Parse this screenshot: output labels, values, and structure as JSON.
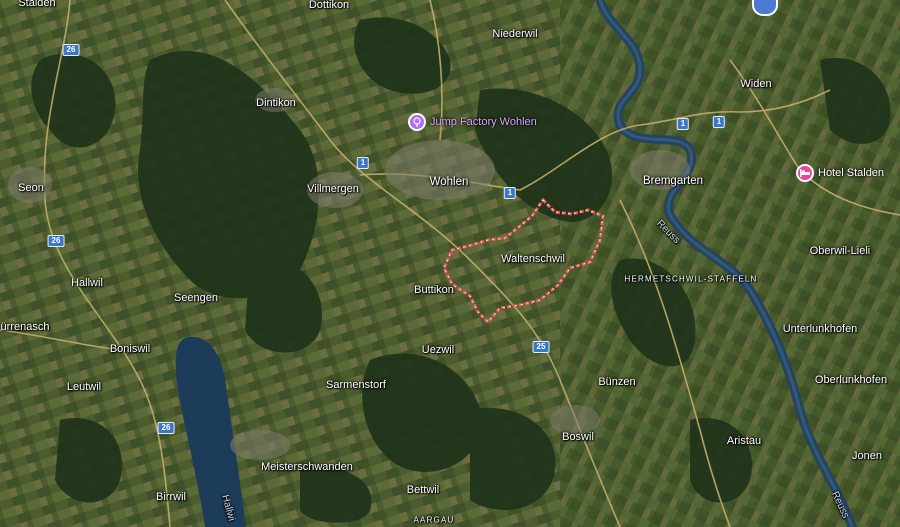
{
  "map": {
    "places": [
      {
        "id": "stalden",
        "label": "Stalden",
        "kind": "village"
      },
      {
        "id": "dottikon",
        "label": "Dottikon",
        "kind": "village"
      },
      {
        "id": "niederwil",
        "label": "Niederwil",
        "kind": "village"
      },
      {
        "id": "widen",
        "label": "Widen",
        "kind": "village"
      },
      {
        "id": "dintikon",
        "label": "Dintikon",
        "kind": "village"
      },
      {
        "id": "seon",
        "label": "Seon",
        "kind": "village"
      },
      {
        "id": "villmergen",
        "label": "Villmergen",
        "kind": "village"
      },
      {
        "id": "wohlen",
        "label": "Wohlen",
        "kind": "town"
      },
      {
        "id": "bremgarten",
        "label": "Bremgarten",
        "kind": "town"
      },
      {
        "id": "oberwil-lieli",
        "label": "Oberwil-Lieli",
        "kind": "village"
      },
      {
        "id": "waltenschwil",
        "label": "Waltenschwil",
        "kind": "village"
      },
      {
        "id": "hermetschwil-staffeln",
        "label": "HERMETSCHWIL-STAFFELN",
        "kind": "district"
      },
      {
        "id": "hallwil",
        "label": "Hallwil",
        "kind": "village"
      },
      {
        "id": "seengen",
        "label": "Seengen",
        "kind": "village"
      },
      {
        "id": "buttikon",
        "label": "Buttikon",
        "kind": "village"
      },
      {
        "id": "urrenasch",
        "label": "ürrenasch",
        "kind": "village"
      },
      {
        "id": "boniswil",
        "label": "Boniswil",
        "kind": "village"
      },
      {
        "id": "uezwil",
        "label": "Uezwil",
        "kind": "village"
      },
      {
        "id": "unterlunkhofen",
        "label": "Unterlunkhofen",
        "kind": "village"
      },
      {
        "id": "leutwil",
        "label": "Leutwil",
        "kind": "village"
      },
      {
        "id": "sarmenstorf",
        "label": "Sarmenstorf",
        "kind": "village"
      },
      {
        "id": "bunzen",
        "label": "Bünzen",
        "kind": "village"
      },
      {
        "id": "oberlunkhofen",
        "label": "Oberlunkhofen",
        "kind": "village"
      },
      {
        "id": "boswil",
        "label": "Boswil",
        "kind": "village"
      },
      {
        "id": "aristau",
        "label": "Aristau",
        "kind": "village"
      },
      {
        "id": "jonen",
        "label": "Jonen",
        "kind": "village"
      },
      {
        "id": "meisterschwanden",
        "label": "Meisterschwanden",
        "kind": "village"
      },
      {
        "id": "bettwil",
        "label": "Bettwil",
        "kind": "village"
      },
      {
        "id": "birrwil",
        "label": "Birrwil",
        "kind": "village"
      },
      {
        "id": "aargau",
        "label": "AARGAU",
        "kind": "district"
      }
    ],
    "water_labels": [
      {
        "id": "reuss-north",
        "label": "Reuss"
      },
      {
        "id": "reuss-south",
        "label": "Reuss"
      },
      {
        "id": "hallwilersee",
        "label": "Hallwi"
      }
    ],
    "road_shields": [
      {
        "id": "r26-a",
        "label": "26"
      },
      {
        "id": "r26-b",
        "label": "26"
      },
      {
        "id": "r26-c",
        "label": "26"
      },
      {
        "id": "r1-a",
        "label": "1"
      },
      {
        "id": "r1-b",
        "label": "1"
      },
      {
        "id": "r1-c",
        "label": "1"
      },
      {
        "id": "r1-d",
        "label": "1"
      },
      {
        "id": "r25",
        "label": "25"
      }
    ],
    "pois": [
      {
        "id": "jump-factory",
        "label": "Jump Factory Wohlen",
        "color": "#b06ef0",
        "label_color": "#d4a5ff",
        "icon": "amusement-icon"
      },
      {
        "id": "hotel-stalden",
        "label": "Hotel Stalden",
        "color": "#e8479c",
        "label_color": "#ffffff",
        "icon": "bed-icon"
      }
    ],
    "boundary": {
      "name": "Waltenschwil",
      "color": "#f05a5a"
    },
    "colors": {
      "forest": "#243a1c",
      "fields": "#4c5a2e",
      "lake": "#1e3e5c",
      "river": "#2a4a62",
      "road": "#c9b26a"
    }
  }
}
